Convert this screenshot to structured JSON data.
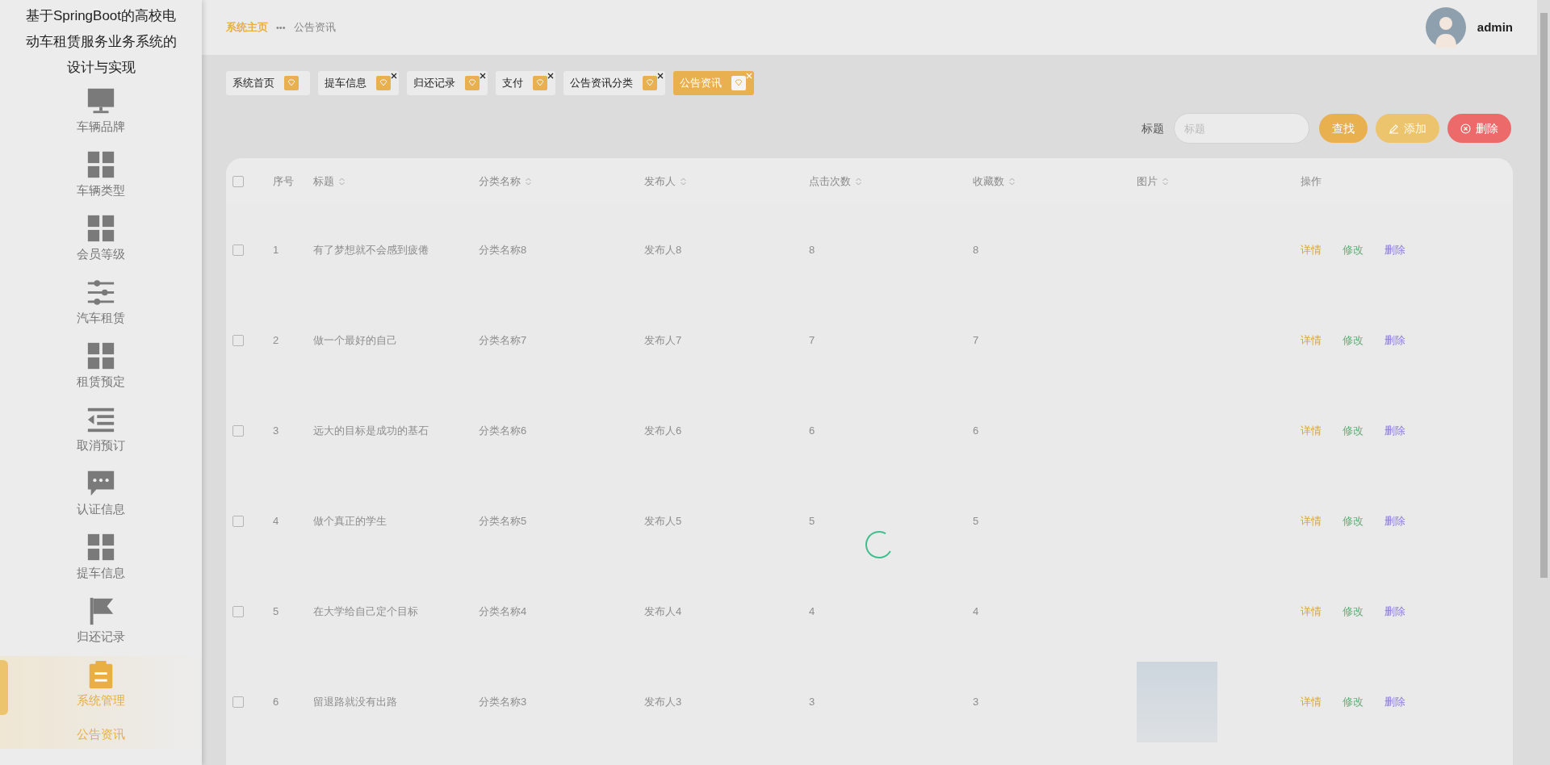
{
  "app_title": "基于SpringBoot的高校电动车租赁服务业务系统的设计与实现",
  "sidebar": {
    "items": [
      {
        "label": "车辆品牌",
        "kind": "monitor",
        "selected": false
      },
      {
        "label": "车辆类型",
        "kind": "grid",
        "selected": false
      },
      {
        "label": "会员等级",
        "kind": "grid",
        "selected": false
      },
      {
        "label": "汽车租赁",
        "kind": "sliders",
        "selected": false
      },
      {
        "label": "租赁预定",
        "kind": "grid",
        "selected": false
      },
      {
        "label": "取消预订",
        "kind": "indent",
        "selected": false
      },
      {
        "label": "认证信息",
        "kind": "chat",
        "selected": false
      },
      {
        "label": "提车信息",
        "kind": "grid",
        "selected": false
      },
      {
        "label": "归还记录",
        "kind": "flag",
        "selected": false
      },
      {
        "label": "系统管理",
        "kind": "clipboard",
        "selected": true,
        "children": [
          {
            "label": "公告资讯",
            "selected": true
          }
        ]
      }
    ]
  },
  "breadcrumb": {
    "items": [
      "系统主页",
      "公告资讯"
    ],
    "separator": "•••"
  },
  "user": {
    "name": "admin"
  },
  "tags": [
    {
      "label": "系统首页",
      "selected": false,
      "closable": false
    },
    {
      "label": "提车信息",
      "selected": false,
      "closable": true
    },
    {
      "label": "归还记录",
      "selected": false,
      "closable": true
    },
    {
      "label": "支付",
      "selected": false,
      "closable": true
    },
    {
      "label": "公告资讯分类",
      "selected": false,
      "closable": true
    },
    {
      "label": "公告资讯",
      "selected": true,
      "closable": true
    }
  ],
  "search": {
    "label": "标题",
    "placeholder": "标题",
    "buttons": [
      {
        "label": "查找",
        "kind": "search"
      },
      {
        "label": "添加",
        "kind": "add"
      },
      {
        "label": "删除",
        "kind": "delete"
      }
    ]
  },
  "table": {
    "all_checked": false,
    "columns": [
      {
        "label": "序号",
        "sortable": false
      },
      {
        "label": "标题",
        "sortable": true
      },
      {
        "label": "分类名称",
        "sortable": true
      },
      {
        "label": "发布人",
        "sortable": true
      },
      {
        "label": "点击次数",
        "sortable": true
      },
      {
        "label": "收藏数",
        "sortable": true
      },
      {
        "label": "图片",
        "sortable": true
      },
      {
        "label": "操作",
        "sortable": false
      }
    ],
    "rows": [
      {
        "checked": false,
        "cells": [
          "1",
          "有了梦想就不会感到疲倦",
          "分类名称8",
          "发布人8",
          "8",
          "8"
        ],
        "has_photo": false,
        "actions": [
          {
            "label": "详情",
            "kind": "detail"
          },
          {
            "label": "修改",
            "kind": "edit"
          },
          {
            "label": "删除",
            "kind": "delete"
          }
        ]
      },
      {
        "checked": false,
        "cells": [
          "2",
          "做一个最好的自己",
          "分类名称7",
          "发布人7",
          "7",
          "7"
        ],
        "has_photo": false,
        "actions": [
          {
            "label": "详情",
            "kind": "detail"
          },
          {
            "label": "修改",
            "kind": "edit"
          },
          {
            "label": "删除",
            "kind": "delete"
          }
        ]
      },
      {
        "checked": false,
        "cells": [
          "3",
          "远大的目标是成功的基石",
          "分类名称6",
          "发布人6",
          "6",
          "6"
        ],
        "has_photo": false,
        "actions": [
          {
            "label": "详情",
            "kind": "detail"
          },
          {
            "label": "修改",
            "kind": "edit"
          },
          {
            "label": "删除",
            "kind": "delete"
          }
        ]
      },
      {
        "checked": false,
        "cells": [
          "4",
          "做个真正的学生",
          "分类名称5",
          "发布人5",
          "5",
          "5"
        ],
        "has_photo": false,
        "actions": [
          {
            "label": "详情",
            "kind": "detail"
          },
          {
            "label": "修改",
            "kind": "edit"
          },
          {
            "label": "删除",
            "kind": "delete"
          }
        ]
      },
      {
        "checked": false,
        "cells": [
          "5",
          "在大学给自己定个目标",
          "分类名称4",
          "发布人4",
          "4",
          "4"
        ],
        "has_photo": false,
        "actions": [
          {
            "label": "详情",
            "kind": "detail"
          },
          {
            "label": "修改",
            "kind": "edit"
          },
          {
            "label": "删除",
            "kind": "delete"
          }
        ]
      },
      {
        "checked": false,
        "cells": [
          "6",
          "留退路就没有出路",
          "分类名称3",
          "发布人3",
          "3",
          "3"
        ],
        "has_photo": true,
        "actions": [
          {
            "label": "详情",
            "kind": "detail"
          },
          {
            "label": "修改",
            "kind": "edit"
          },
          {
            "label": "删除",
            "kind": "delete"
          }
        ]
      }
    ]
  }
}
